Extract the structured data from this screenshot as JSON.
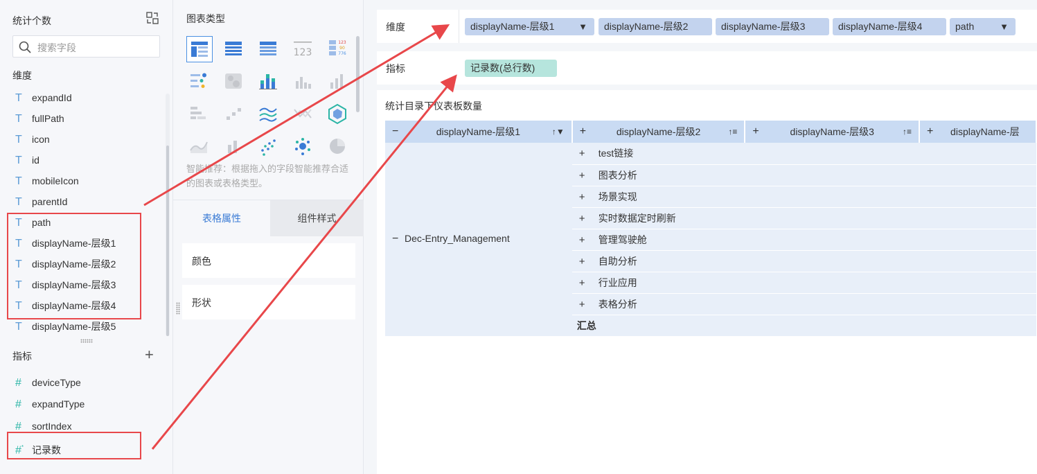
{
  "left": {
    "title": "统计个数",
    "search_placeholder": "搜索字段",
    "dimension_label": "维度",
    "dimensions": [
      "expandId",
      "fullPath",
      "icon",
      "id",
      "mobileIcon",
      "parentId",
      "path",
      "displayName-层级1",
      "displayName-层级2",
      "displayName-层级3",
      "displayName-层级4",
      "displayName-层级5"
    ],
    "measure_label": "指标",
    "measures": [
      "deviceType",
      "expandType",
      "sortIndex",
      "记录数"
    ]
  },
  "middle": {
    "title": "图表类型",
    "hint": "智能推荐：根据拖入的字段智能推荐合适的图表或表格类型。",
    "tab_active": "表格属性",
    "tab_inactive": "组件样式",
    "props": [
      "颜色",
      "形状"
    ],
    "chart_icons": [
      "grouped-table-icon",
      "detail-table-icon",
      "cross-table-icon",
      "kpi-number-icon",
      "kpi-table-icon",
      "dot-matrix-icon",
      "heatmap-icon",
      "stacked-bar-icon",
      "bar-icon",
      "bar-chart-icon",
      "range-bar-icon",
      "scatter-bar-icon",
      "multi-line-icon",
      "line-icon",
      "radar-icon",
      "area-icon",
      "column-icon",
      "scatter-icon",
      "bubble-icon",
      "pie-icon"
    ]
  },
  "right": {
    "dimension_label": "维度",
    "dimension_pills": [
      "displayName-层级1",
      "displayName-层级2",
      "displayName-层级3",
      "displayName-层级4",
      "path"
    ],
    "measure_label": "指标",
    "measure_pills": [
      "记录数(总行数)"
    ],
    "canvas_title": "统计目录下仪表板数量",
    "table": {
      "headers": [
        "displayName-层级1",
        "displayName-层级2",
        "displayName-层级3",
        "displayName-层"
      ],
      "row_group": "Dec-Entry_Management",
      "rows": [
        "test链接",
        "图表分析",
        "场景实现",
        "实时数据定时刷新",
        "管理驾驶舱",
        "自助分析",
        "行业应用",
        "表格分析"
      ],
      "total_label": "汇总"
    }
  },
  "colors": {
    "accent": "#3a7bd5",
    "annotation_red": "#e8474a",
    "dim_pill": "#c3d3ee",
    "measure_pill": "#b6e5dd"
  }
}
